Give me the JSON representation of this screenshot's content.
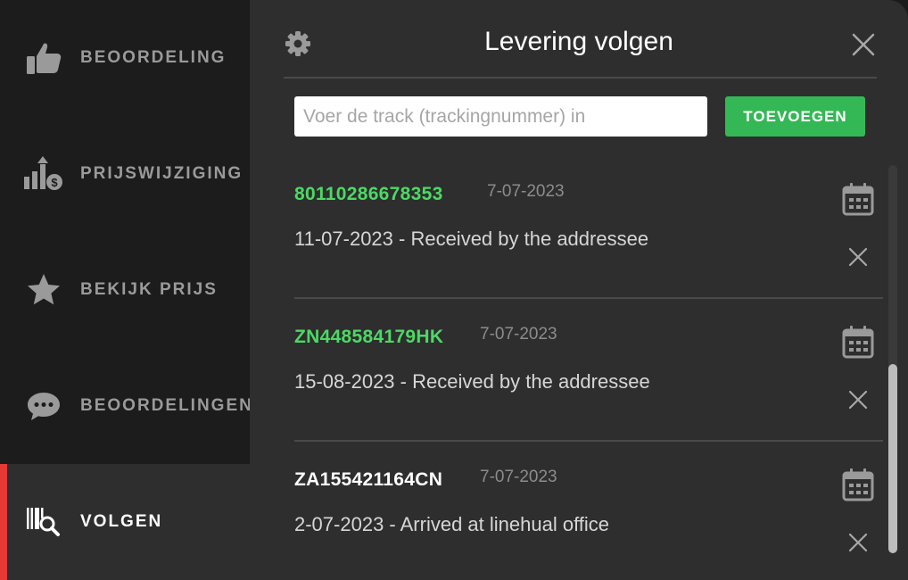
{
  "sidebar": {
    "items": [
      {
        "label": "BEOORDELING",
        "icon": "thumbs-up-icon"
      },
      {
        "label": "PRIJSWIJZIGING",
        "icon": "price-change-icon"
      },
      {
        "label": "BEKIJK PRIJS",
        "icon": "star-icon"
      },
      {
        "label": "BEOORDELINGEN",
        "icon": "chat-bubble-icon"
      },
      {
        "label": "VOLGEN",
        "icon": "barcode-search-icon",
        "active": true
      }
    ]
  },
  "header": {
    "title": "Levering volgen"
  },
  "search": {
    "placeholder": "Voer de track (trackingnummer) in"
  },
  "add_button": {
    "label": "TOEVOEGEN"
  },
  "tracks": [
    {
      "number": "80110286678353",
      "date": "7-07-2023",
      "status": "11-07-2023 - Received by the addressee",
      "number_color": "#4cd964"
    },
    {
      "number": "ZN448584179HK",
      "date": "7-07-2023",
      "status": "15-08-2023 - Received by the addressee",
      "number_color": "#4cd964"
    },
    {
      "number": "ZA155421164CN",
      "date": "7-07-2023",
      "status": "2-07-2023 - Arrived at linehual office",
      "number_color": "#ffffff"
    }
  ],
  "colors": {
    "accent_active": "#e53935",
    "add_button": "#34b856",
    "delivered": "#4cd964"
  }
}
